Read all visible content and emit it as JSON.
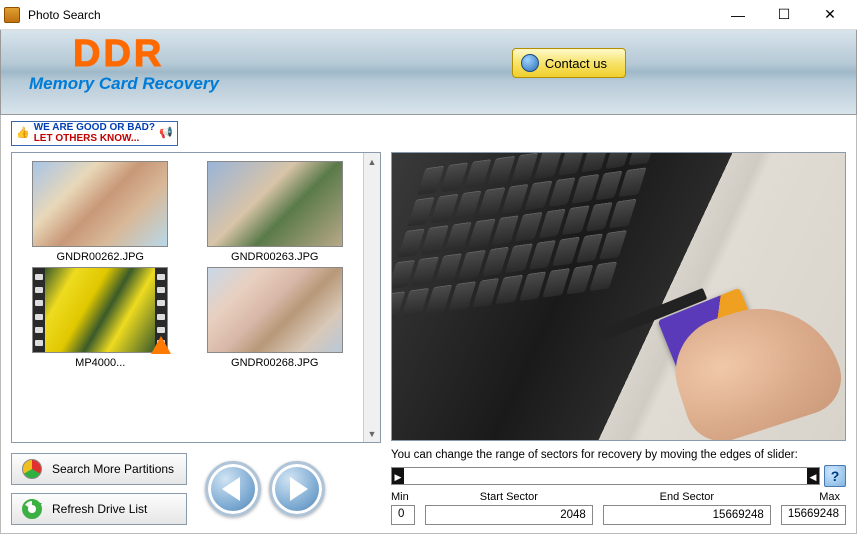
{
  "window": {
    "title": "Photo Search"
  },
  "header": {
    "logo": "DDR",
    "subtitle": "Memory Card Recovery",
    "contact": "Contact us"
  },
  "feedback": {
    "line1": "WE ARE GOOD OR BAD?",
    "line2": "LET OTHERS KNOW..."
  },
  "thumbnails": {
    "items": [
      {
        "caption": "GNDR00262.JPG"
      },
      {
        "caption": "GNDR00263.JPG"
      },
      {
        "caption": "MP4000..."
      },
      {
        "caption": "GNDR00268.JPG"
      }
    ]
  },
  "buttons": {
    "search_more": "Search More Partitions",
    "refresh_drive": "Refresh Drive List"
  },
  "sector": {
    "instruction": "You can change the range of sectors for recovery by moving the edges of slider:",
    "labels": {
      "min": "Min",
      "start": "Start Sector",
      "end": "End Sector",
      "max": "Max"
    },
    "values": {
      "min": "0",
      "start": "2048",
      "end": "15669248",
      "max": "15669248"
    },
    "help": "?"
  }
}
